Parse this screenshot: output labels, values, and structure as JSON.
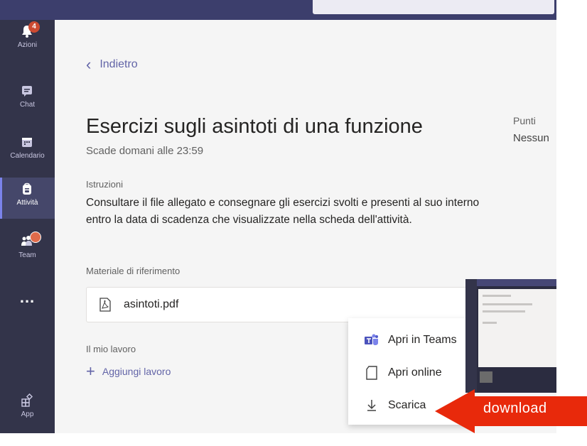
{
  "rail": {
    "items": [
      {
        "label": "Azioni",
        "icon": "bell-icon",
        "badge": "4"
      },
      {
        "label": "Chat",
        "icon": "chat-icon"
      },
      {
        "label": "Calendario",
        "icon": "calendar-icon"
      },
      {
        "label": "Attività",
        "icon": "backpack-icon",
        "active": true
      },
      {
        "label": "Team",
        "icon": "teams-icon"
      },
      {
        "label": "...",
        "icon": "more-icon"
      },
      {
        "label": "App",
        "icon": "apps-icon"
      }
    ]
  },
  "back": {
    "label": "Indietro"
  },
  "assignment": {
    "title": "Esercizi sugli asintoti di una funzione",
    "due": "Scade domani alle 23:59",
    "points_label": "Punti",
    "points_value": "Nessun",
    "instructions_label": "Istruzioni",
    "instructions": "Consultare il file allegato e consegnare gli esercizi svolti e presenti al suo interno entro la data di scadenza che visualizzate nella scheda dell'attività.",
    "reference_label": "Materiale di riferimento",
    "file_name": "asintoti.pdf",
    "my_work_label": "Il mio lavoro",
    "add_work": "Aggiungi lavoro"
  },
  "context_menu": {
    "items": [
      {
        "label": "Apri in Teams",
        "icon": "teams-icon"
      },
      {
        "label": "Apri online",
        "icon": "open-online-icon"
      },
      {
        "label": "Scarica",
        "icon": "download-icon"
      }
    ]
  },
  "annotation": {
    "label": "download"
  },
  "colors": {
    "rail": "#33344a",
    "accent": "#6264a7",
    "arrow": "#e8290b",
    "topbar": "#3c3e6c"
  }
}
